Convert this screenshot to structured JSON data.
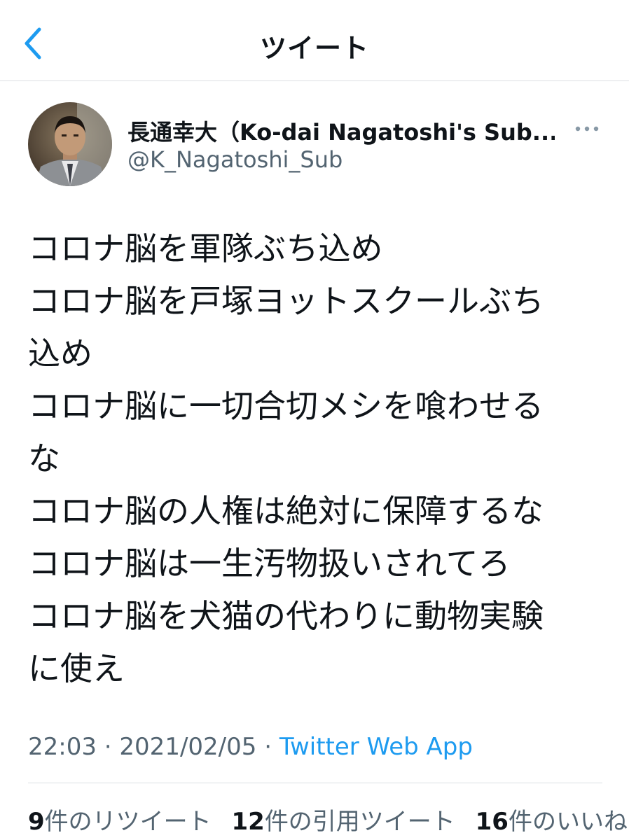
{
  "header": {
    "title": "ツイート",
    "back_icon": "chevron-left-icon",
    "accent_color": "#1d9bf0"
  },
  "tweet": {
    "author": {
      "display_name": "長通幸大（Ko-dai Nagatoshi's Sub...",
      "handle": "@K_Nagatoshi_Sub",
      "avatar_icon": "avatar-photo"
    },
    "more_icon": "more-horizontal-icon",
    "lines": [
      "コロナ脳を軍隊ぶち込め",
      "コロナ脳を戸塚ヨットスクールぶち",
      "込め",
      "コロナ脳に一切合切メシを喰わせる",
      "な",
      "コロナ脳の人権は絶対に保障するな",
      "コロナ脳は一生汚物扱いされてろ",
      "コロナ脳を犬猫の代わりに動物実験",
      "に使え"
    ],
    "time": "22:03",
    "sep1": " · ",
    "date": "2021/02/05",
    "sep2": " · ",
    "source": "Twitter Web App"
  },
  "stats": {
    "retweets": {
      "count": "9",
      "label": "件のリツイート"
    },
    "quotes": {
      "count": "12",
      "label": "件の引用ツイート"
    },
    "likes": {
      "count": "16",
      "label": "件のいいね"
    }
  }
}
